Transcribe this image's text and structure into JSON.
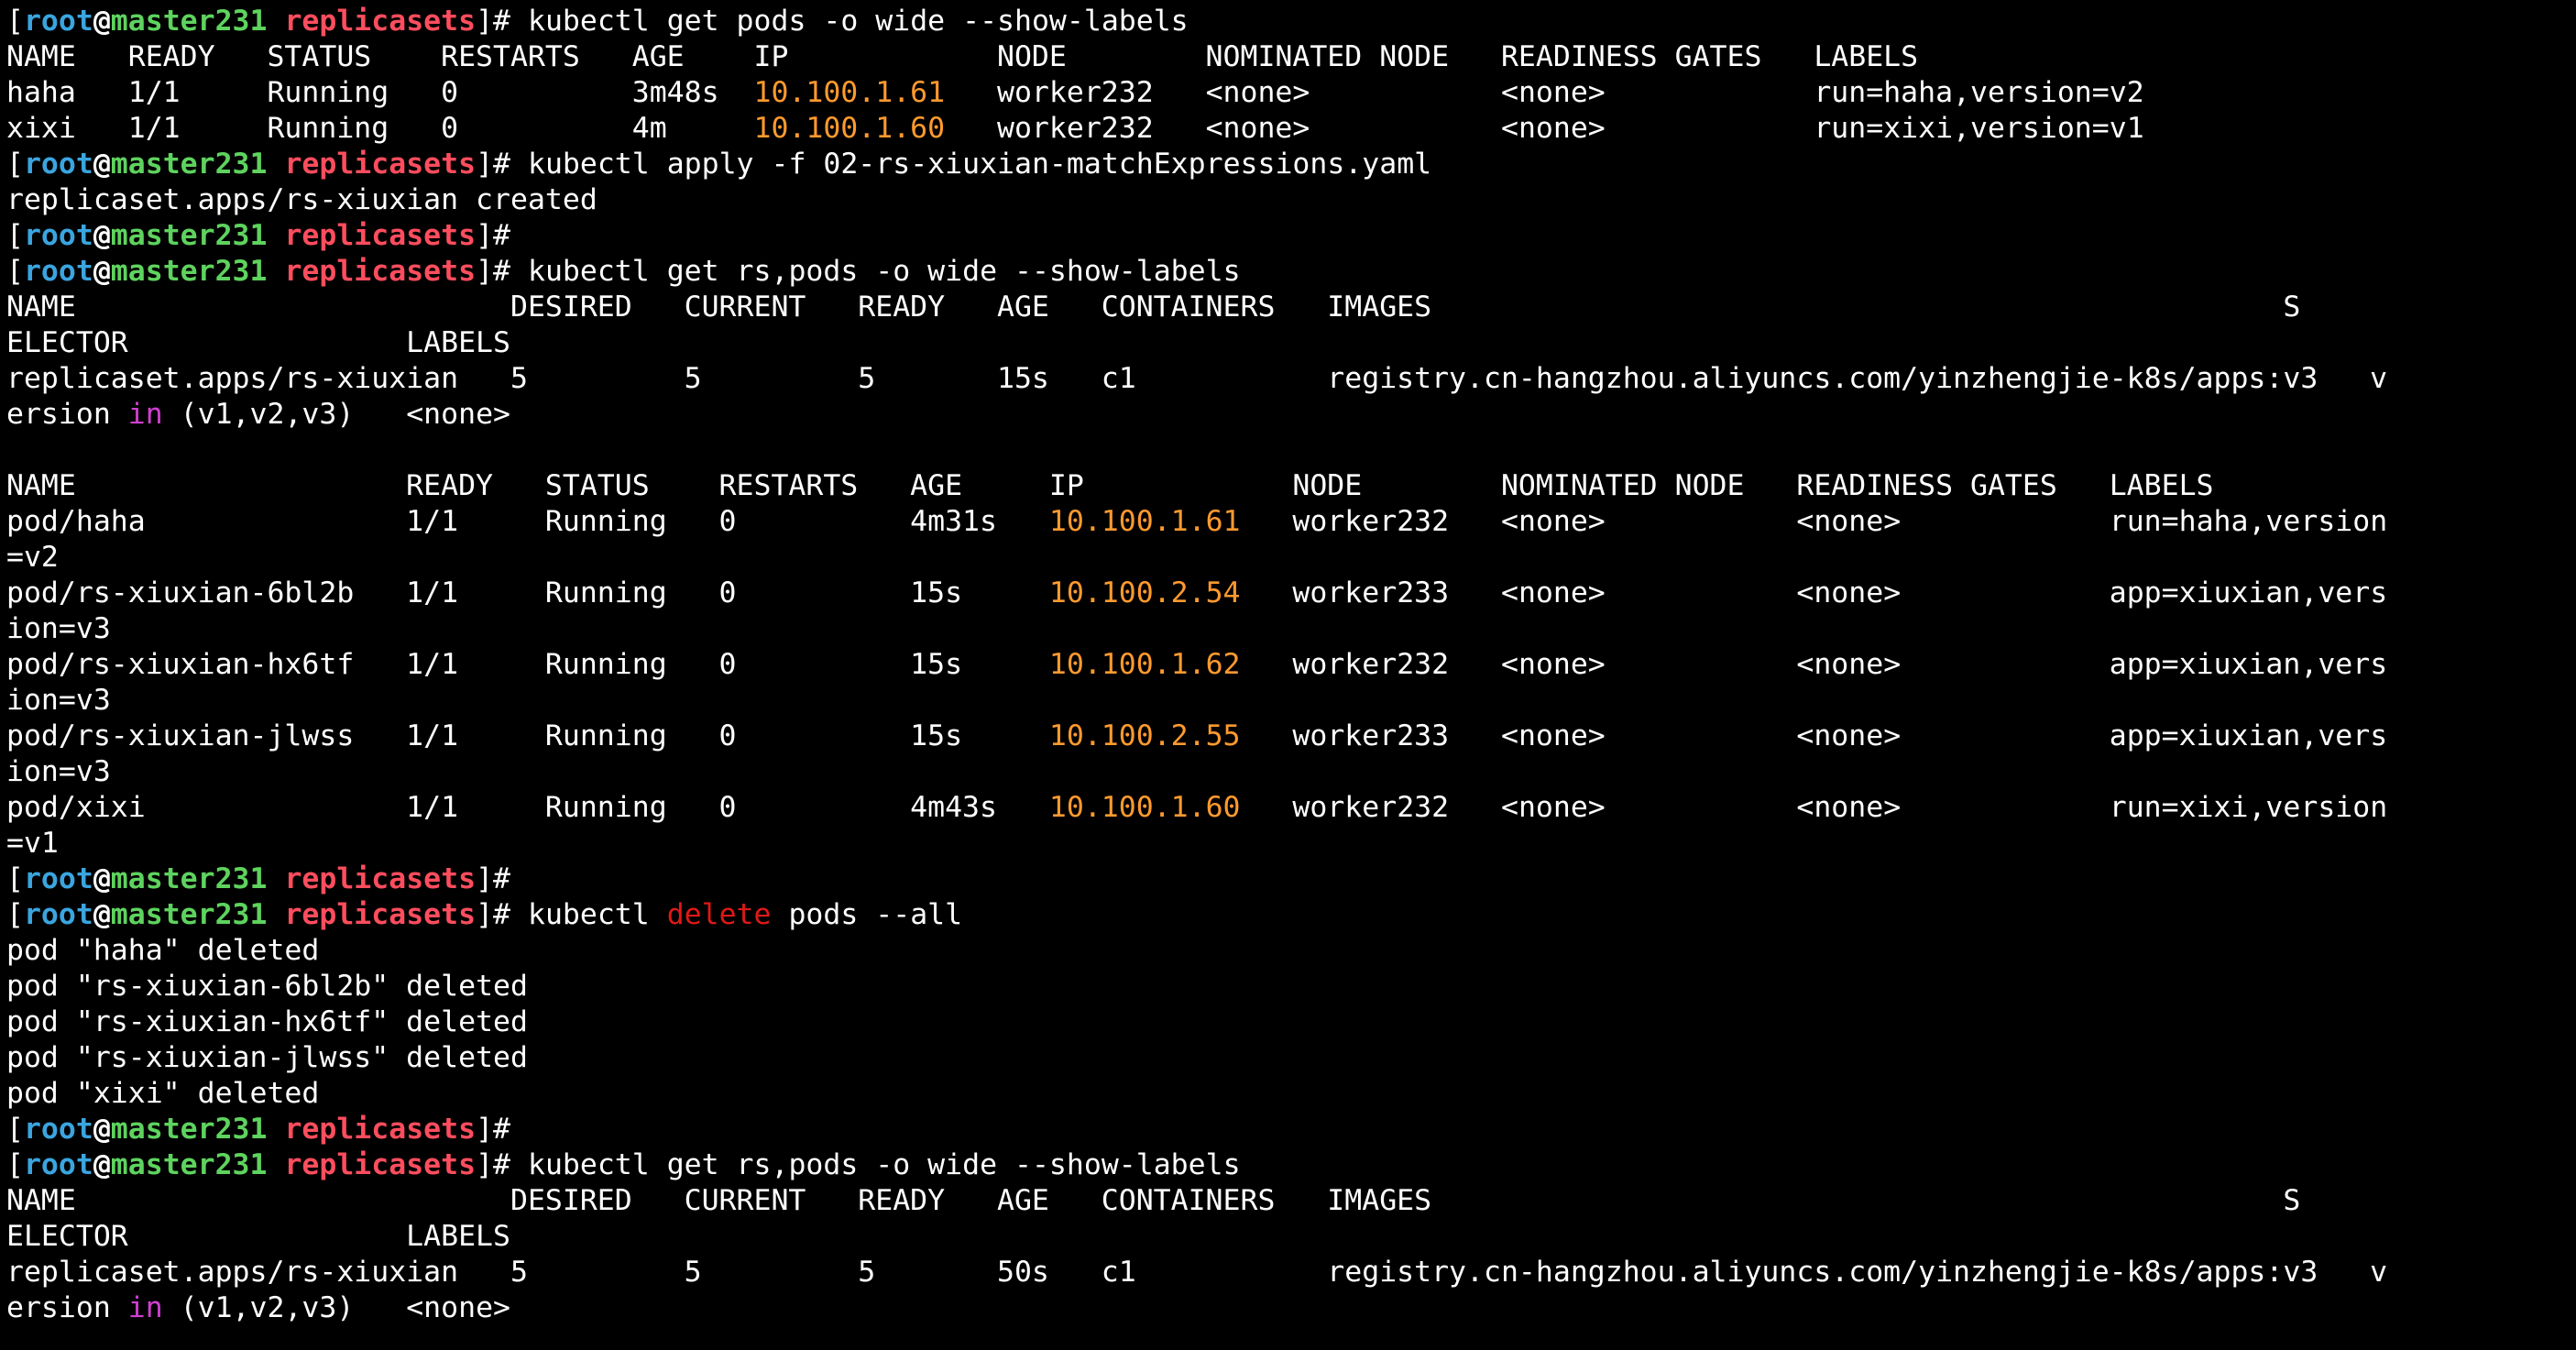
{
  "colors": {
    "background": "#000000",
    "text": "#ffffff",
    "prompt_user": "#3aa5e0",
    "prompt_host": "#5ed35e",
    "prompt_dir": "#ff4d5e",
    "ip": "#ff9a2e",
    "keyword_in": "#d040d0",
    "delete": "#e01818"
  },
  "terminal": {
    "prompt": {
      "open_bracket": "[",
      "user": "root",
      "at": "@",
      "host": "master231",
      "space": " ",
      "dir": "replicasets",
      "close": "]# "
    },
    "lines": [
      {
        "type": "cmd",
        "cmd": "kubectl get pods -o wide --show-labels"
      },
      {
        "type": "out",
        "segs": [
          {
            "t": "NAME   READY   STATUS    RESTARTS   AGE    IP            NODE        NOMINATED NODE   READINESS GATES   LABELS"
          }
        ]
      },
      {
        "type": "out",
        "segs": [
          {
            "t": "haha   1/1     Running   0          3m48s  "
          },
          {
            "t": "10.100.1.61",
            "c": "ip"
          },
          {
            "t": "   worker232   <none>           <none>            run=haha,version=v2"
          }
        ]
      },
      {
        "type": "out",
        "segs": [
          {
            "t": "xixi   1/1     Running   0          4m     "
          },
          {
            "t": "10.100.1.60",
            "c": "ip"
          },
          {
            "t": "   worker232   <none>           <none>            run=xixi,version=v1"
          }
        ]
      },
      {
        "type": "cmd",
        "cmd": "kubectl apply -f 02-rs-xiuxian-matchExpressions.yaml"
      },
      {
        "type": "out",
        "segs": [
          {
            "t": "replicaset.apps/rs-xiuxian created"
          }
        ]
      },
      {
        "type": "cmd",
        "cmd": ""
      },
      {
        "type": "cmd",
        "cmd": "kubectl get rs,pods -o wide --show-labels"
      },
      {
        "type": "out",
        "segs": [
          {
            "t": "NAME                         DESIRED   CURRENT   READY   AGE   CONTAINERS   IMAGES                                                 S"
          }
        ]
      },
      {
        "type": "out",
        "segs": [
          {
            "t": "ELECTOR                LABELS"
          }
        ]
      },
      {
        "type": "out",
        "segs": [
          {
            "t": "replicaset.apps/rs-xiuxian   5         5         5       15s   c1           registry.cn-hangzhou.aliyuncs.com/yinzhengjie-k8s/apps:v3   v"
          }
        ]
      },
      {
        "type": "out",
        "segs": [
          {
            "t": "ersion "
          },
          {
            "t": "in",
            "c": "kw"
          },
          {
            "t": " (v1,v2,v3)   <none>"
          }
        ]
      },
      {
        "type": "out",
        "segs": [
          {
            "t": ""
          }
        ]
      },
      {
        "type": "out",
        "segs": [
          {
            "t": "NAME                   READY   STATUS    RESTARTS   AGE     IP            NODE        NOMINATED NODE   READINESS GATES   LABELS"
          }
        ]
      },
      {
        "type": "out",
        "segs": [
          {
            "t": "pod/haha               1/1     Running   0          4m31s   "
          },
          {
            "t": "10.100.1.61",
            "c": "ip"
          },
          {
            "t": "   worker232   <none>           <none>            run=haha,version"
          }
        ]
      },
      {
        "type": "out",
        "segs": [
          {
            "t": "=v2"
          }
        ]
      },
      {
        "type": "out",
        "segs": [
          {
            "t": "pod/rs-xiuxian-6bl2b   1/1     Running   0          15s     "
          },
          {
            "t": "10.100.2.54",
            "c": "ip"
          },
          {
            "t": "   worker233   <none>           <none>            app=xiuxian,vers"
          }
        ]
      },
      {
        "type": "out",
        "segs": [
          {
            "t": "ion=v3"
          }
        ]
      },
      {
        "type": "out",
        "segs": [
          {
            "t": "pod/rs-xiuxian-hx6tf   1/1     Running   0          15s     "
          },
          {
            "t": "10.100.1.62",
            "c": "ip"
          },
          {
            "t": "   worker232   <none>           <none>            app=xiuxian,vers"
          }
        ]
      },
      {
        "type": "out",
        "segs": [
          {
            "t": "ion=v3"
          }
        ]
      },
      {
        "type": "out",
        "segs": [
          {
            "t": "pod/rs-xiuxian-jlwss   1/1     Running   0          15s     "
          },
          {
            "t": "10.100.2.55",
            "c": "ip"
          },
          {
            "t": "   worker233   <none>           <none>            app=xiuxian,vers"
          }
        ]
      },
      {
        "type": "out",
        "segs": [
          {
            "t": "ion=v3"
          }
        ]
      },
      {
        "type": "out",
        "segs": [
          {
            "t": "pod/xixi               1/1     Running   0          4m43s   "
          },
          {
            "t": "10.100.1.60",
            "c": "ip"
          },
          {
            "t": "   worker232   <none>           <none>            run=xixi,version"
          }
        ]
      },
      {
        "type": "out",
        "segs": [
          {
            "t": "=v1"
          }
        ]
      },
      {
        "type": "cmd",
        "cmd": ""
      },
      {
        "type": "cmd",
        "cmd_segs": [
          {
            "t": "kubectl "
          },
          {
            "t": "delete",
            "c": "del"
          },
          {
            "t": " pods --all"
          }
        ]
      },
      {
        "type": "out",
        "segs": [
          {
            "t": "pod \"haha\" deleted"
          }
        ]
      },
      {
        "type": "out",
        "segs": [
          {
            "t": "pod \"rs-xiuxian-6bl2b\" deleted"
          }
        ]
      },
      {
        "type": "out",
        "segs": [
          {
            "t": "pod \"rs-xiuxian-hx6tf\" deleted"
          }
        ]
      },
      {
        "type": "out",
        "segs": [
          {
            "t": "pod \"rs-xiuxian-jlwss\" deleted"
          }
        ]
      },
      {
        "type": "out",
        "segs": [
          {
            "t": "pod \"xixi\" deleted"
          }
        ]
      },
      {
        "type": "cmd",
        "cmd": ""
      },
      {
        "type": "cmd",
        "cmd": "kubectl get rs,pods -o wide --show-labels"
      },
      {
        "type": "out",
        "segs": [
          {
            "t": "NAME                         DESIRED   CURRENT   READY   AGE   CONTAINERS   IMAGES                                                 S"
          }
        ]
      },
      {
        "type": "out",
        "segs": [
          {
            "t": "ELECTOR                LABELS"
          }
        ]
      },
      {
        "type": "out",
        "segs": [
          {
            "t": "replicaset.apps/rs-xiuxian   5         5         5       50s   c1           registry.cn-hangzhou.aliyuncs.com/yinzhengjie-k8s/apps:v3   v"
          }
        ]
      },
      {
        "type": "out",
        "segs": [
          {
            "t": "ersion "
          },
          {
            "t": "in",
            "c": "kw"
          },
          {
            "t": " (v1,v2,v3)   <none>"
          }
        ]
      }
    ]
  }
}
